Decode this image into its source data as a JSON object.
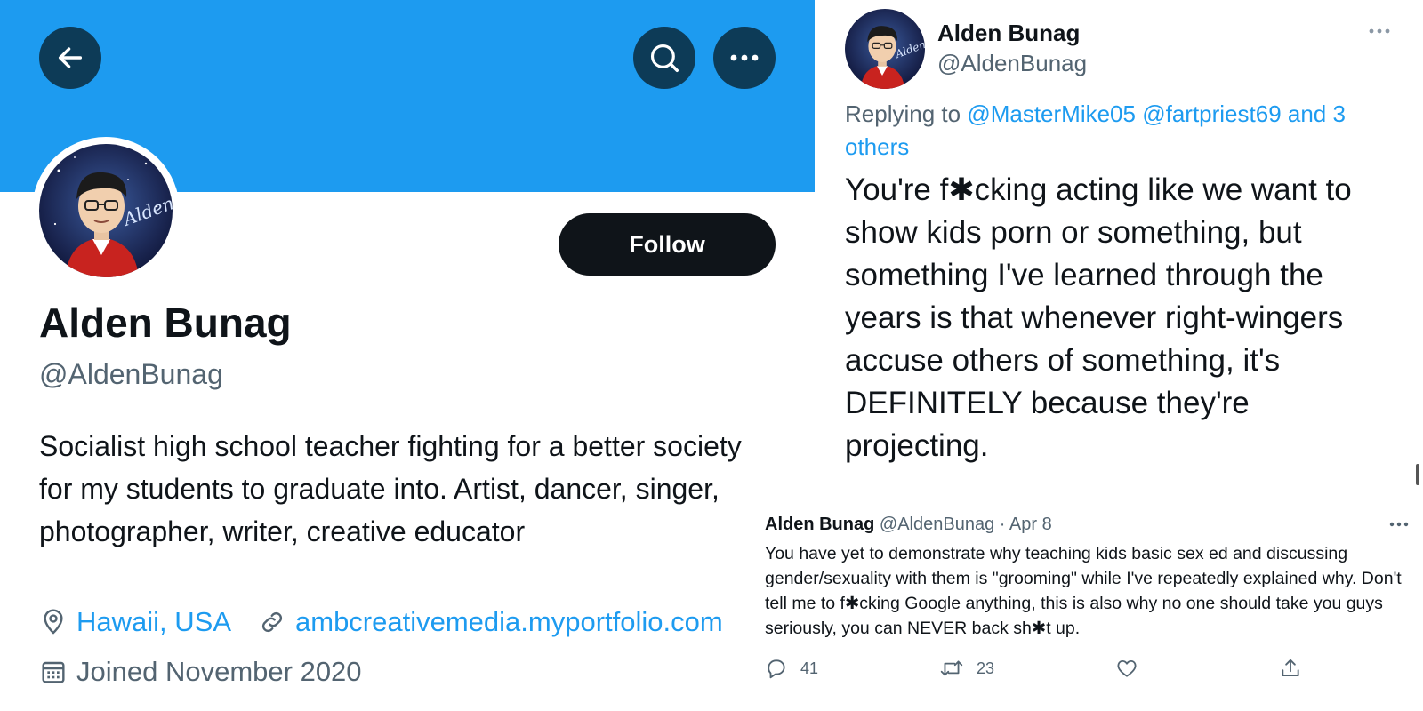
{
  "profile": {
    "name": "Alden Bunag",
    "handle": "@AldenBunag",
    "follow_label": "Follow",
    "bio": "Socialist high school teacher fighting for a better society for my students to graduate into. Artist, dancer, singer, photographer, writer, creative educator",
    "location": "Hawaii, USA",
    "website": "ambcreativemedia.myportfolio.com",
    "joined": "Joined November 2020",
    "avatar_text": "Alden",
    "banner_color": "#1d9bf0",
    "header_button_color": "#0d3b57",
    "icons": {
      "back": "back-arrow-icon",
      "search": "search-icon",
      "more": "more-dots-icon",
      "location": "location-pin-icon",
      "link": "link-icon",
      "calendar": "calendar-icon"
    }
  },
  "reply_tweet": {
    "name": "Alden Bunag",
    "handle": "@AldenBunag",
    "replying_prefix": "Replying to",
    "replying_mentions": "@MasterMike05 @fartpriest69 and 3 others",
    "text": "You're f✱cking acting like we want to show kids porn or something, but something I've learned through the years is that whenever right-wingers accuse others of something, it's DEFINITELY because they're projecting."
  },
  "quoted_tweet": {
    "name": "Alden Bunag",
    "handle": "@AldenBunag",
    "separator": "·",
    "date": "Apr 8",
    "text": "You have yet to demonstrate why teaching kids basic sex ed and discussing gender/sexuality with them is \"grooming\" while I've repeatedly explained why. Don't tell me to f✱cking Google anything, this is also why no one should take you guys seriously, you can NEVER back sh✱t up.",
    "replies": "41",
    "retweets": "23",
    "icons": {
      "reply": "reply-bubble-icon",
      "retweet": "retweet-icon",
      "like": "heart-icon",
      "share": "share-icon"
    }
  },
  "colors": {
    "accent": "#1d9bf0",
    "text": "#0f1419",
    "muted": "#536471",
    "button_dark": "#0f1419"
  }
}
